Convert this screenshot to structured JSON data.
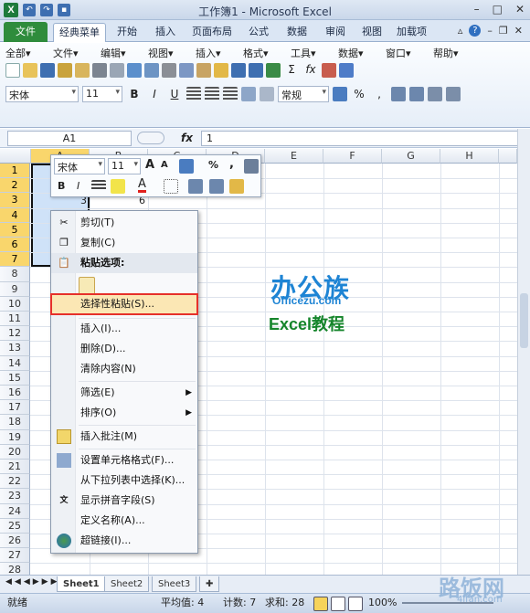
{
  "window": {
    "title": "工作簿1 - Microsoft Excel",
    "minimize": "–",
    "maximize": "□",
    "close": "✕"
  },
  "qat": {
    "logo": "X",
    "undo": "↶",
    "redo": "↷",
    "save": "▪"
  },
  "tabs": [
    "文件",
    "经典菜单",
    "开始",
    "插入",
    "页面布局",
    "公式",
    "数据",
    "审阅",
    "视图",
    "加载项"
  ],
  "ribbon": {
    "menus": [
      "全部▾",
      "文件▾",
      "编辑▾",
      "视图▾",
      "插入▾",
      "格式▾",
      "工具▾",
      "数据▾",
      "窗口▾",
      "帮助▾"
    ],
    "font": "宋体",
    "size": "11",
    "number_format": "常规",
    "buttons": [
      "B",
      "I",
      "U",
      "%",
      ",",
      "Σ",
      "fx"
    ]
  },
  "formula": {
    "name_box": "A1",
    "fx": "fx",
    "value": "1"
  },
  "columns": [
    "A",
    "B",
    "C",
    "D",
    "E",
    "F",
    "G",
    "H"
  ],
  "rows": [
    "1",
    "2",
    "3",
    "4",
    "5",
    "6",
    "7",
    "8",
    "9",
    "10",
    "11",
    "12",
    "13",
    "14",
    "15",
    "16",
    "17",
    "18",
    "19",
    "20",
    "21",
    "22",
    "23",
    "24",
    "25",
    "26",
    "27",
    "28"
  ],
  "cells": {
    "a3": "3",
    "b3": "6"
  },
  "minibar": {
    "font": "宋体",
    "size": "11",
    "grow": "A",
    "shrink": "A",
    "percent": "%",
    "comma": ",",
    "bold": "B",
    "italic": "I"
  },
  "context_menu": {
    "cut": "剪切(T)",
    "copy": "复制(C)",
    "paste_options": "粘贴选项:",
    "paste_special": "选择性粘贴(S)...",
    "insert": "插入(I)...",
    "delete": "删除(D)...",
    "clear": "清除内容(N)",
    "filter": "筛选(E)",
    "sort": "排序(O)",
    "comment": "插入批注(M)",
    "format_cells": "设置单元格格式(F)...",
    "pick_list": "从下拉列表中选择(K)...",
    "phonetic": "显示拼音字段(S)",
    "define_name": "定义名称(A)...",
    "hyperlink": "超链接(I)..."
  },
  "sheets": [
    "Sheet1",
    "Sheet2",
    "Sheet3"
  ],
  "status": {
    "ready": "就绪",
    "average": "平均值: 4",
    "count": "计数: 7",
    "sum": "求和: 28",
    "zoom": "100%"
  },
  "watermark": {
    "brand": "办公族",
    "site": "Officezu.com",
    "tagline": "Excel教程",
    "corner": "路饭网",
    "corner_url": "4lfan.com"
  }
}
